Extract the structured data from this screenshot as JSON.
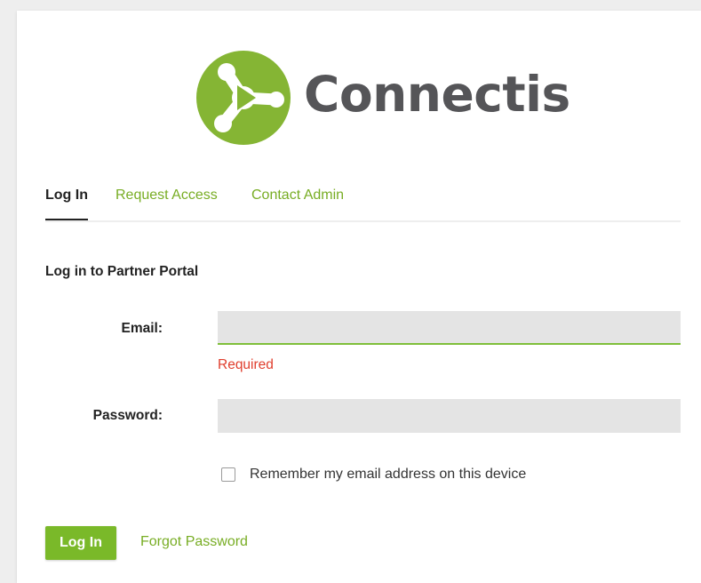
{
  "brand": {
    "name": "Connectis",
    "logo_icon": "connectis-play-icon",
    "primary_color": "#7ab929",
    "logo_color": "#85b534",
    "text_color": "#555558"
  },
  "tabs": [
    {
      "label": "Log In",
      "active": true
    },
    {
      "label": "Request Access",
      "active": false
    },
    {
      "label": "Contact Admin",
      "active": false
    }
  ],
  "form": {
    "title": "Log in to Partner Portal",
    "email": {
      "label": "Email:",
      "value": "",
      "placeholder": "",
      "error": "Required"
    },
    "password": {
      "label": "Password:",
      "value": "",
      "placeholder": ""
    },
    "remember": {
      "label": "Remember my email address on this device",
      "checked": false
    },
    "submit_label": "Log In",
    "forgot_label": "Forgot Password"
  },
  "colors": {
    "accent": "#78ad24",
    "error": "#e03e2d",
    "input_background": "#e4e4e4"
  }
}
